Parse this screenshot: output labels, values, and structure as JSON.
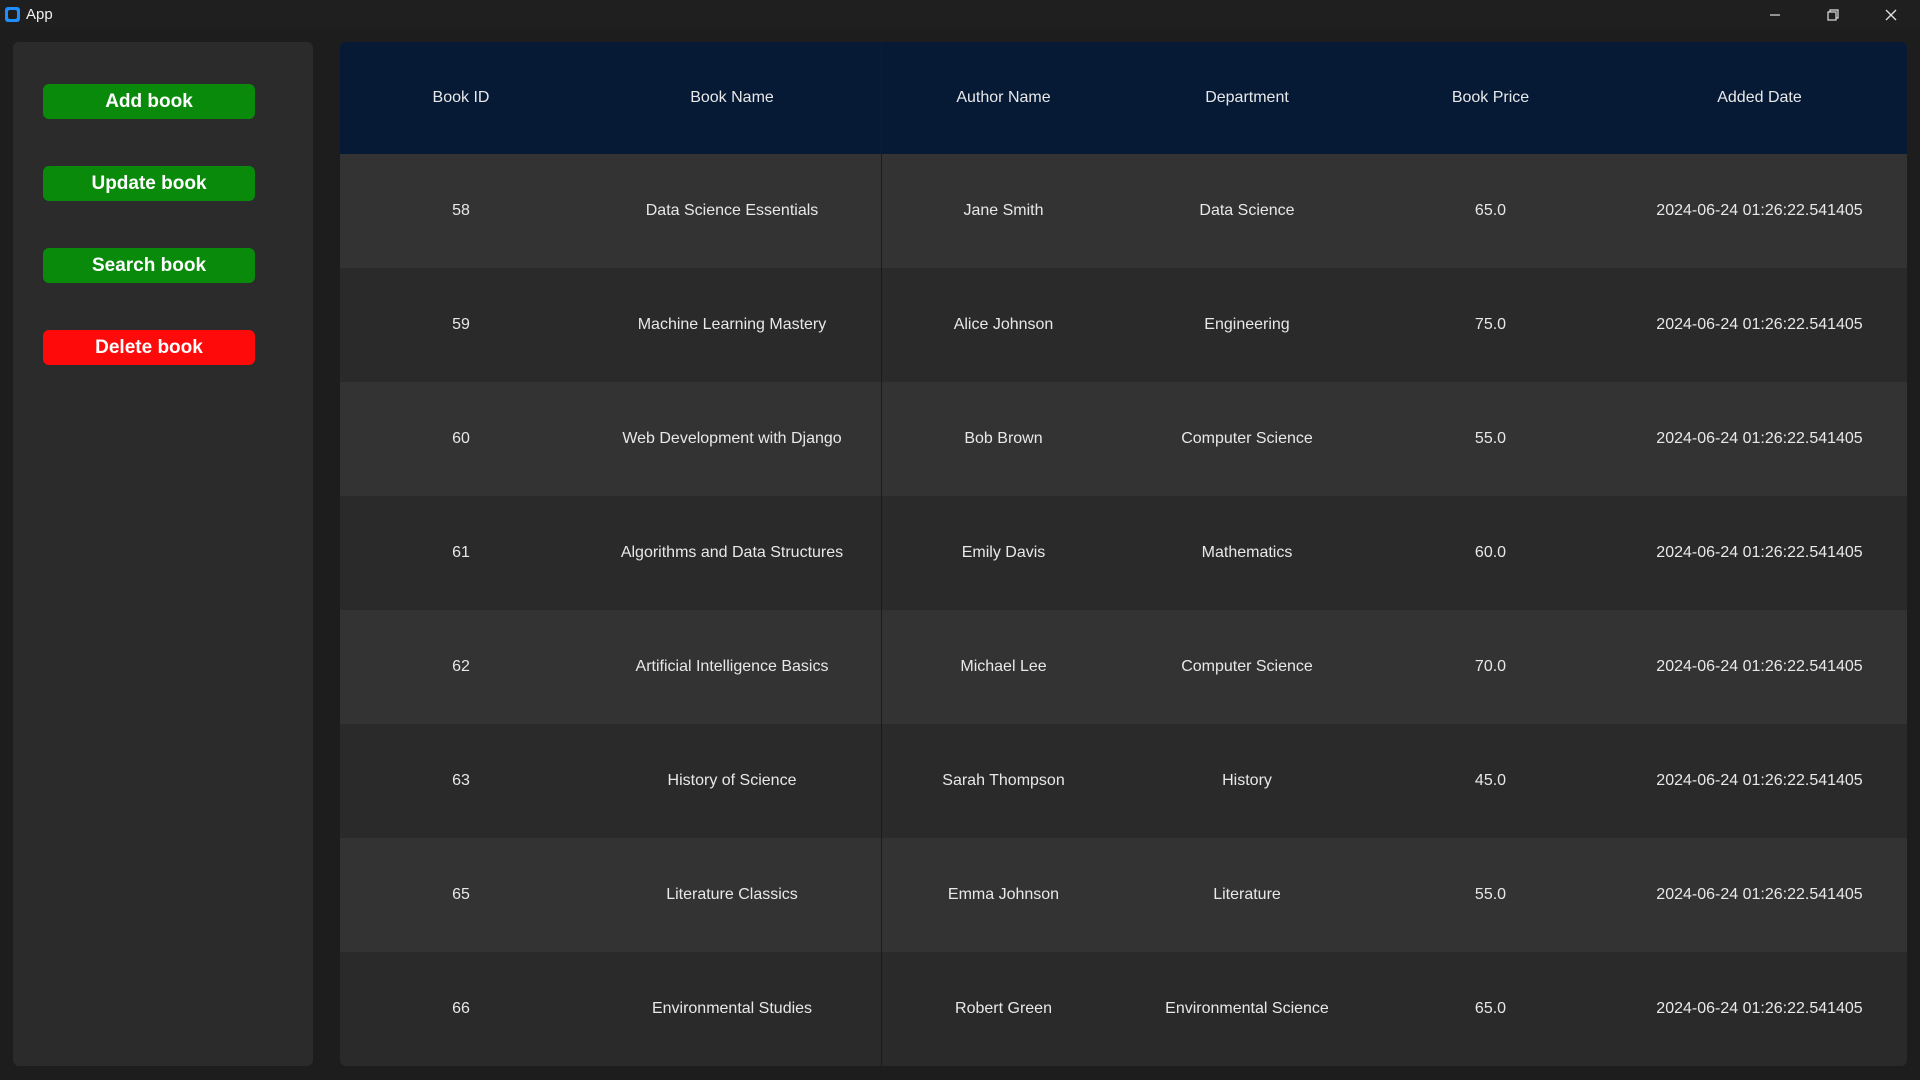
{
  "window": {
    "title": "App",
    "controls": [
      "minimize-icon",
      "restore-icon",
      "close-icon"
    ]
  },
  "sidebar": {
    "buttons": [
      {
        "label": "Add book",
        "color": "#0a8a0a"
      },
      {
        "label": "Update book",
        "color": "#0a8a0a"
      },
      {
        "label": "Search book",
        "color": "#0a8a0a"
      },
      {
        "label": "Delete book",
        "color": "#ff0a0a"
      }
    ]
  },
  "table": {
    "header_color": "#061a36",
    "columns": [
      "Book ID",
      "Book Name",
      "Author Name",
      "Department",
      "Book Price",
      "Added Date"
    ],
    "rows": [
      [
        "58",
        "Data Science Essentials",
        "Jane Smith",
        "Data Science",
        "65.0",
        "2024-06-24 01:26:22.541405"
      ],
      [
        "59",
        "Machine Learning Mastery",
        "Alice Johnson",
        "Engineering",
        "75.0",
        "2024-06-24 01:26:22.541405"
      ],
      [
        "60",
        "Web Development with Django",
        "Bob Brown",
        "Computer Science",
        "55.0",
        "2024-06-24 01:26:22.541405"
      ],
      [
        "61",
        "Algorithms and Data Structures",
        "Emily Davis",
        "Mathematics",
        "60.0",
        "2024-06-24 01:26:22.541405"
      ],
      [
        "62",
        "Artificial Intelligence Basics",
        "Michael Lee",
        "Computer Science",
        "70.0",
        "2024-06-24 01:26:22.541405"
      ],
      [
        "63",
        "History of Science",
        "Sarah Thompson",
        "History",
        "45.0",
        "2024-06-24 01:26:22.541405"
      ],
      [
        "65",
        "Literature Classics",
        "Emma Johnson",
        "Literature",
        "55.0",
        "2024-06-24 01:26:22.541405"
      ],
      [
        "66",
        "Environmental Studies",
        "Robert Green",
        "Environmental Science",
        "65.0",
        "2024-06-24 01:26:22.541405"
      ]
    ]
  }
}
